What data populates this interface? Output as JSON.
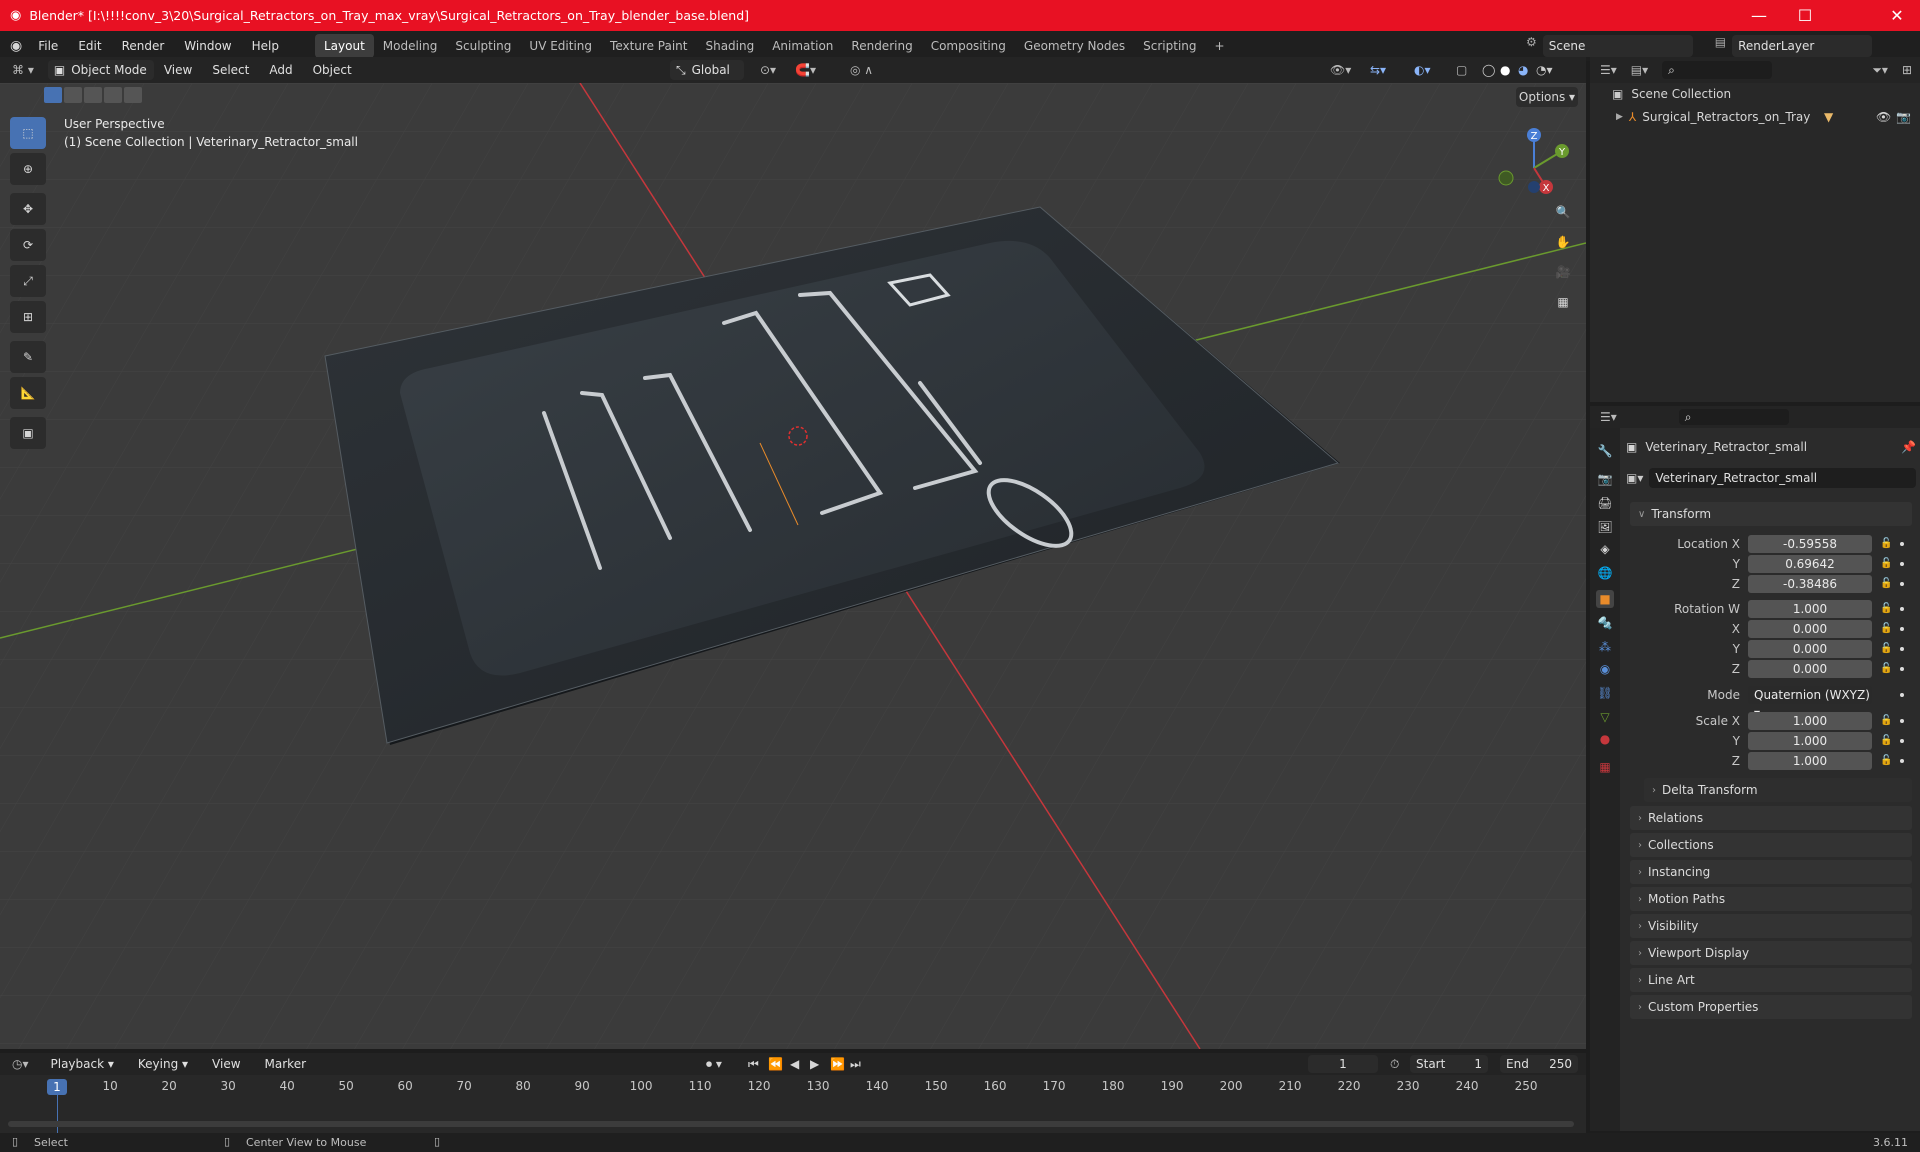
{
  "window": {
    "title": "Blender* [I:\\!!!!conv_3\\20\\Surgical_Retractors_on_Tray_max_vray\\Surgical_Retractors_on_Tray_blender_base.blend]"
  },
  "menus": [
    "File",
    "Edit",
    "Render",
    "Window",
    "Help"
  ],
  "workspaces": [
    "Layout",
    "Modeling",
    "Sculpting",
    "UV Editing",
    "Texture Paint",
    "Shading",
    "Animation",
    "Rendering",
    "Compositing",
    "Geometry Nodes",
    "Scripting"
  ],
  "active_workspace": "Layout",
  "scene": {
    "name": "Scene",
    "render_layer": "RenderLayer"
  },
  "viewport_header": {
    "mode": "Object Mode",
    "menus": [
      "View",
      "Select",
      "Add",
      "Object"
    ],
    "orientation": "Global",
    "options": "Options"
  },
  "viewport": {
    "perspective": "User Perspective",
    "collection_line": "(1) Scene Collection | Veterinary_Retractor_small"
  },
  "gizmo": {
    "x": "X",
    "y": "Y",
    "z": "Z"
  },
  "outliner": {
    "root": "Scene Collection",
    "items": [
      "Surgical_Retractors_on_Tray"
    ]
  },
  "properties": {
    "object_name": "Veterinary_Retractor_small",
    "data_name": "Veterinary_Retractor_small",
    "transform_label": "Transform",
    "location_label": "Location X",
    "location": [
      "-0.59558",
      "0.69642",
      "-0.38486"
    ],
    "rotation_label": "Rotation W",
    "rotation": [
      "1.000",
      "0.000",
      "0.000",
      "0.000"
    ],
    "mode_label": "Mode",
    "mode_value": "Quaternion (WXYZ)",
    "scale_label": "Scale X",
    "scale": [
      "1.000",
      "1.000",
      "1.000"
    ],
    "axis_labels": [
      "X",
      "Y",
      "Z"
    ],
    "delta": "Delta Transform",
    "panels": [
      "Relations",
      "Collections",
      "Instancing",
      "Motion Paths",
      "Visibility",
      "Viewport Display",
      "Line Art",
      "Custom Properties"
    ]
  },
  "timeline": {
    "menus": [
      "Playback",
      "Keying",
      "View",
      "Marker"
    ],
    "current_frame": "1",
    "start_label": "Start",
    "start": "1",
    "end_label": "End",
    "end": "250",
    "ticks": [
      "10",
      "20",
      "30",
      "40",
      "50",
      "60",
      "70",
      "80",
      "90",
      "100",
      "110",
      "120",
      "130",
      "140",
      "150",
      "160",
      "170",
      "180",
      "190",
      "200",
      "210",
      "220",
      "230",
      "240",
      "250"
    ]
  },
  "status": {
    "left": "Select",
    "middle": "Center View to Mouse",
    "version": "3.6.11"
  },
  "colors": {
    "titlebar": "#e81123",
    "accent": "#4772b3",
    "x_axis": "#c5373c",
    "y_axis": "#6a9a2e",
    "selected": "#e98b2a"
  }
}
